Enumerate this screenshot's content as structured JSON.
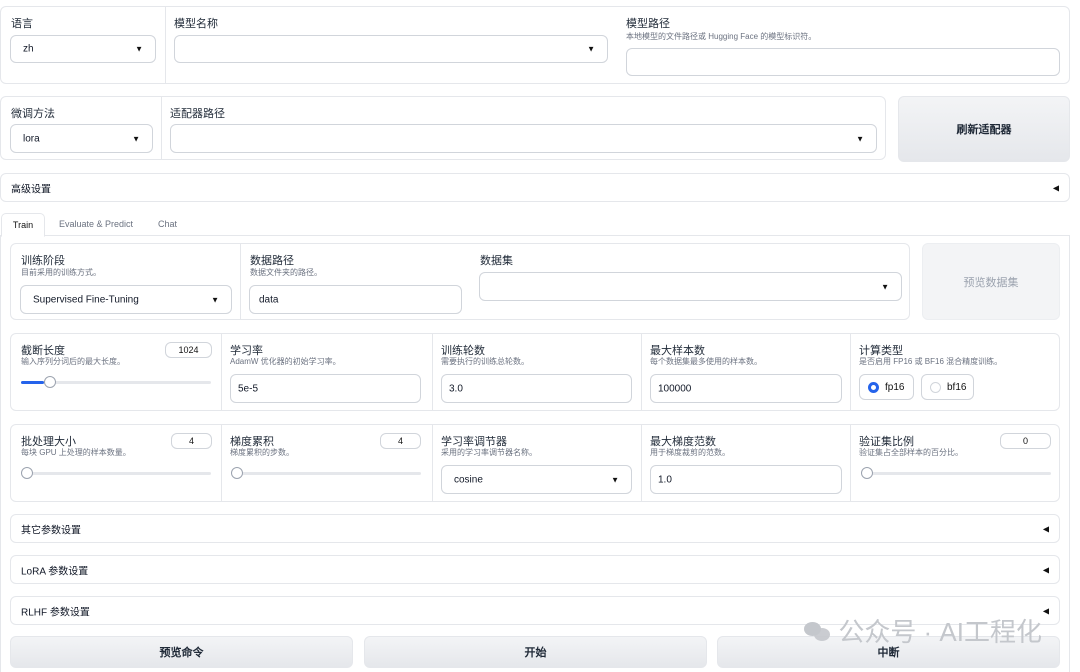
{
  "top": {
    "lang_label": "语言",
    "lang_value": "zh",
    "model_name_label": "模型名称",
    "model_name_value": "",
    "model_path_label": "模型路径",
    "model_path_hint": "本地模型的文件路径或 Hugging Face 的模型标识符。",
    "model_path_value": ""
  },
  "row2": {
    "finetune_label": "微调方法",
    "finetune_value": "lora",
    "adapter_label": "适配器路径",
    "adapter_value": "",
    "refresh_button": "刷新适配器"
  },
  "advanced": {
    "label": "高级设置"
  },
  "tabs": [
    {
      "label": "Train",
      "active": true
    },
    {
      "label": "Evaluate & Predict",
      "active": false
    },
    {
      "label": "Chat",
      "active": false
    }
  ],
  "train": {
    "stage_label": "训练阶段",
    "stage_hint": "目前采用的训练方式。",
    "stage_value": "Supervised Fine-Tuning",
    "datapath_label": "数据路径",
    "datapath_hint": "数据文件夹的路径。",
    "datapath_value": "data",
    "dataset_label": "数据集",
    "dataset_value": "",
    "preview_dataset_button": "预览数据集"
  },
  "params1": {
    "cutoff_label": "截断长度",
    "cutoff_hint": "输入序列分词后的最大长度。",
    "cutoff_value": "1024",
    "cutoff_slider_fraction": 0.12,
    "lr_label": "学习率",
    "lr_hint": "AdamW 优化器的初始学习率。",
    "lr_value": "5e-5",
    "epochs_label": "训练轮数",
    "epochs_hint": "需要执行的训练总轮数。",
    "epochs_value": "3.0",
    "max_samples_label": "最大样本数",
    "max_samples_hint": "每个数据集最多使用的样本数。",
    "max_samples_value": "100000",
    "compute_label": "计算类型",
    "compute_hint": "是否启用 FP16 或 BF16 混合精度训练。",
    "compute_options": [
      "fp16",
      "bf16"
    ],
    "compute_selected": "fp16"
  },
  "params2": {
    "batch_label": "批处理大小",
    "batch_hint": "每块 GPU 上处理的样本数量。",
    "batch_value": "4",
    "batch_slider_fraction": 0.0,
    "accum_label": "梯度累积",
    "accum_hint": "梯度累积的步数。",
    "accum_value": "4",
    "accum_slider_fraction": 0.0,
    "scheduler_label": "学习率调节器",
    "scheduler_hint": "采用的学习率调节器名称。",
    "scheduler_value": "cosine",
    "maxgrad_label": "最大梯度范数",
    "maxgrad_hint": "用于梯度裁剪的范数。",
    "maxgrad_value": "1.0",
    "valsize_label": "验证集比例",
    "valsize_hint": "验证集占全部样本的百分比。",
    "valsize_value": "0",
    "valsize_slider_fraction": 0.0
  },
  "sections": {
    "other": "其它参数设置",
    "lora": "LoRA 参数设置",
    "rlhf": "RLHF 参数设置"
  },
  "actions": {
    "preview_cmd": "预览命令",
    "start": "开始",
    "stop": "中断"
  },
  "watermark": "公众号 · AI工程化",
  "colors": {
    "accent": "#2563eb",
    "border": "#e5e7eb"
  },
  "icons": {
    "dropdown": "caret-down-icon",
    "collapse": "triangle-left-icon"
  }
}
